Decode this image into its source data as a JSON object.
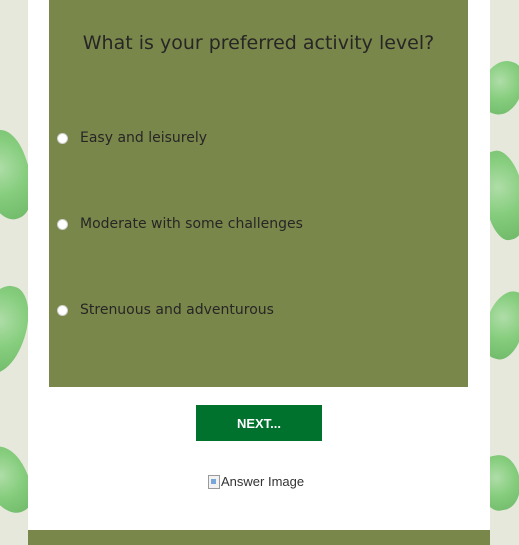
{
  "quiz": {
    "question": "What is your preferred activity level?",
    "options": [
      {
        "label": "Easy and leisurely",
        "selected": false
      },
      {
        "label": "Moderate with some challenges",
        "selected": false
      },
      {
        "label": "Strenuous and adventurous",
        "selected": false
      }
    ],
    "next_label": "NEXT...",
    "answer_image_alt": "Answer Image"
  },
  "colors": {
    "question_box": "#7a874a",
    "next_button": "#00722d",
    "page_background": "#e6e8dc",
    "leaf_accent": "#7ccb74"
  },
  "icons": {
    "radio": "radio-unchecked-icon",
    "answer_image": "broken-image-icon"
  }
}
